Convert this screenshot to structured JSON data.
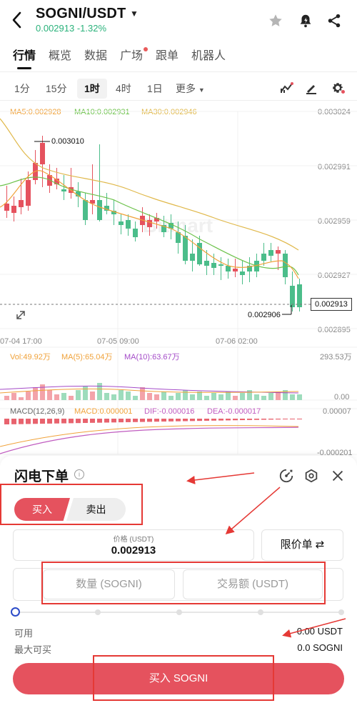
{
  "header": {
    "pair": "SOGNI/USDT",
    "price_change": "0.002913 -1.32%"
  },
  "tabs": [
    {
      "label": "行情",
      "active": true
    },
    {
      "label": "概览"
    },
    {
      "label": "数据"
    },
    {
      "label": "广场",
      "dot": true
    },
    {
      "label": "跟单"
    },
    {
      "label": "机器人"
    }
  ],
  "intervals": [
    {
      "label": "1分"
    },
    {
      "label": "15分"
    },
    {
      "label": "1时",
      "active": true
    },
    {
      "label": "4时"
    },
    {
      "label": "1日"
    },
    {
      "label": "更多"
    }
  ],
  "chart": {
    "ma_legend": {
      "ma5": "MA5:0.002928",
      "ma10": "MA10:0.002931",
      "ma30": "MA30:0.002946"
    },
    "price_axis": [
      "0.003024",
      "0.002991",
      "0.002959",
      "0.002927",
      "0.002895"
    ],
    "current_price_tag": "0.002913",
    "high_label": "0.003010",
    "low_label": "0.002906",
    "watermark": "Bitmart",
    "time_labels": [
      "07-04 17:00",
      "07-05 09:00",
      "07-06 02:00"
    ],
    "vol_legend": {
      "vol": "Vol:49.92万",
      "ma5": "MA(5):65.04万",
      "ma10": "MA(10):63.67万"
    },
    "vol_axis": [
      "293.53万",
      "0.00"
    ],
    "macd_legend": {
      "macd_params": "MACD(12,26,9)",
      "macd": "MACD:0.000001",
      "dif": "DIF:-0.000016",
      "dea": "DEA:-0.000017"
    },
    "macd_axis": [
      "0.00007",
      "-0.000201"
    ],
    "colors": {
      "up": "#e5525e",
      "down": "#4bbd8a",
      "ma5": "#f0a23a",
      "ma10": "#6cc24a",
      "ma30": "#e0b84a",
      "vol_ma10": "#a44bc8"
    }
  },
  "panel": {
    "title": "闪电下单",
    "buy_label": "买入",
    "sell_label": "卖出",
    "price_label": "价格 (USDT)",
    "price_value": "0.002913",
    "order_type": "限价单 ⇄",
    "qty_placeholder": "数量 (SOGNI)",
    "amount_placeholder": "交易额 (USDT)",
    "slider_value_percent": 0,
    "available_label": "可用",
    "available_value": "0.00 USDT",
    "max_buy_label": "最大可买",
    "max_buy_value": "0.0 SOGNI",
    "buy_button": "买入 SOGNI"
  },
  "accent_colors": {
    "buy": "#e5525e",
    "sell_bg": "#eeeeee",
    "annotation": "#e53935",
    "slider": "#2c4cc9"
  }
}
